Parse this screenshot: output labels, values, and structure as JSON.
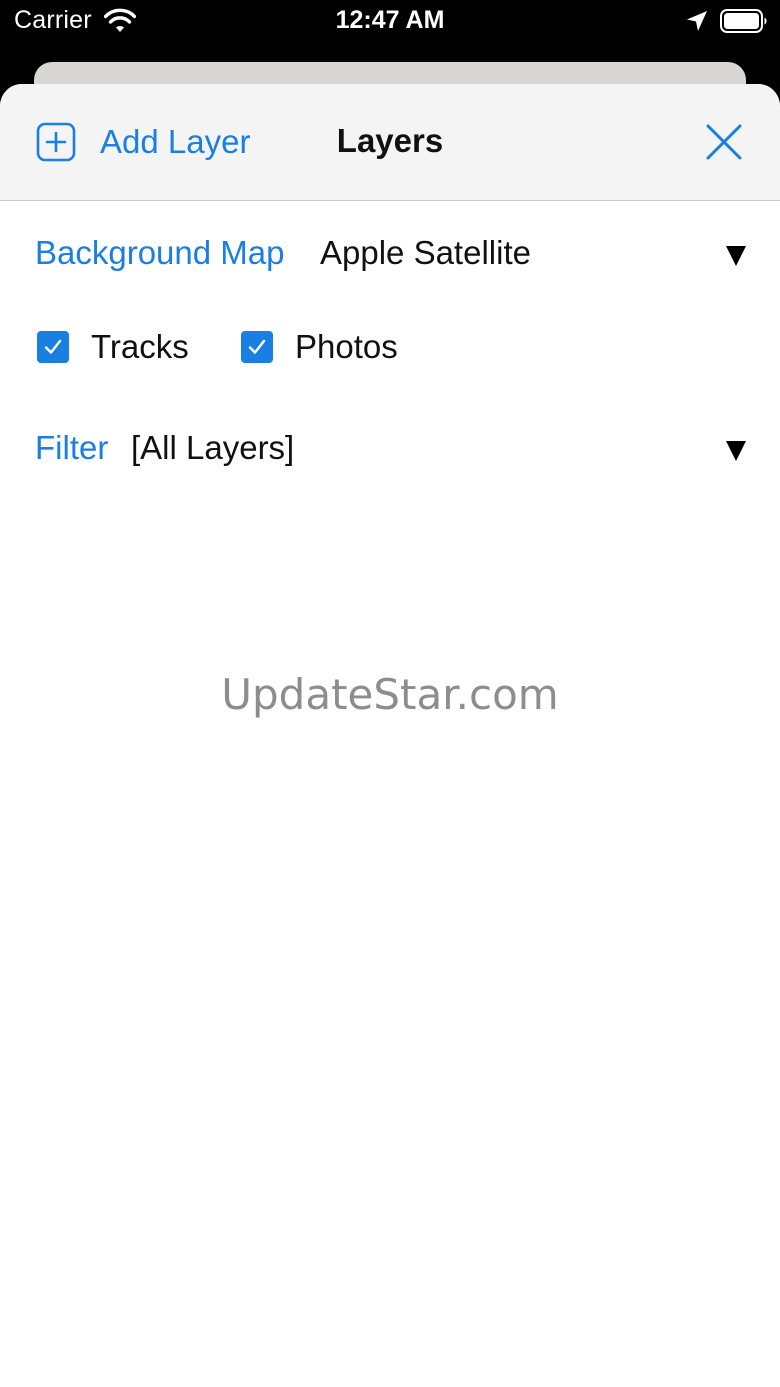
{
  "status_bar": {
    "carrier": "Carrier",
    "time": "12:47 AM",
    "icons": [
      "wifi-icon",
      "location-arrow-icon",
      "battery-icon"
    ]
  },
  "nav": {
    "add_layer_label": "Add Layer",
    "title": "Layers",
    "icons": [
      "plus-square-icon",
      "close-icon"
    ]
  },
  "background_map": {
    "label": "Background Map",
    "value": "Apple Satellite"
  },
  "layers": [
    {
      "label": "Tracks",
      "checked": true
    },
    {
      "label": "Photos",
      "checked": true
    }
  ],
  "filter": {
    "label": "Filter",
    "value": "[All Layers]"
  },
  "watermark": "UpdateStar.com",
  "colors": {
    "accent": "#1a7fe3",
    "nav_background": "#f4f4f4",
    "text": "#111111",
    "watermark": "#8d8d8d"
  }
}
